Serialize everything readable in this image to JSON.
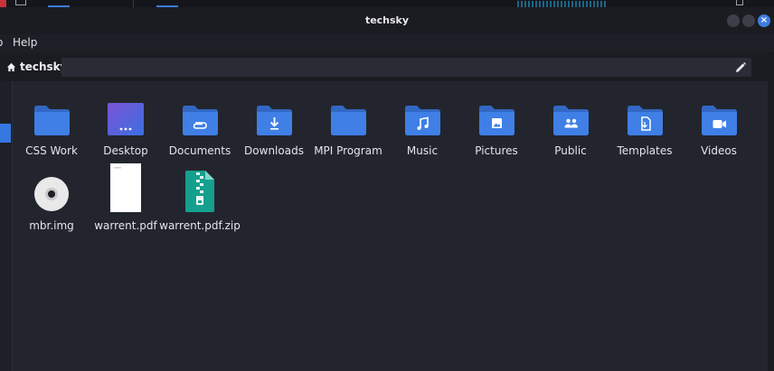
{
  "window": {
    "title": "techsky",
    "close_glyph": "×"
  },
  "menubar": {
    "partial_item": "o",
    "help": "Help"
  },
  "location": {
    "breadcrumb": "techsky",
    "home_icon": "home-icon",
    "edit_icon": "pencil-icon"
  },
  "colors": {
    "folder": "#3f7fe6",
    "folder_dark": "#3268c4",
    "accent": "#3478e0",
    "background": "#23252e"
  },
  "files": [
    {
      "label": "CSS Work",
      "icon": "folder-icon"
    },
    {
      "label": "Desktop",
      "icon": "desktop-folder-icon"
    },
    {
      "label": "Documents",
      "icon": "documents-folder-icon"
    },
    {
      "label": "Downloads",
      "icon": "downloads-folder-icon"
    },
    {
      "label": "MPI Program",
      "icon": "folder-icon"
    },
    {
      "label": "Music",
      "icon": "music-folder-icon"
    },
    {
      "label": "Pictures",
      "icon": "pictures-folder-icon"
    },
    {
      "label": "Public",
      "icon": "public-folder-icon"
    },
    {
      "label": "Templates",
      "icon": "templates-folder-icon"
    },
    {
      "label": "Videos",
      "icon": "videos-folder-icon"
    },
    {
      "label": "mbr.img",
      "icon": "disc-image-icon"
    },
    {
      "label": "warrent.pdf",
      "icon": "pdf-file-icon"
    },
    {
      "label": "warrent.pdf.zip",
      "icon": "zip-archive-icon"
    }
  ]
}
